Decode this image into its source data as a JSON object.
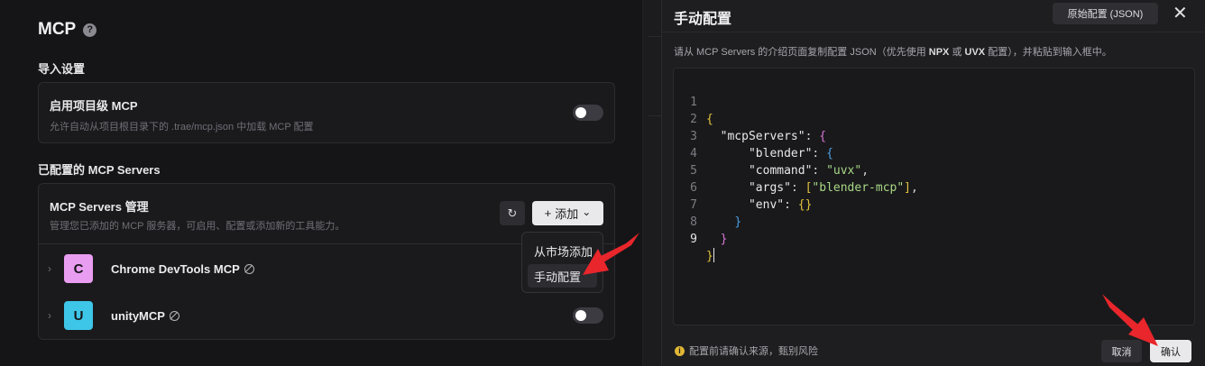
{
  "settings": {
    "title": "MCP",
    "help_icon": "?",
    "import_section": "导入设置",
    "project_mcp": {
      "title": "启用项目级 MCP",
      "desc": "允许自动从项目根目录下的 .trae/mcp.json 中加载 MCP 配置",
      "enabled": false
    },
    "configured_section": "已配置的 MCP Servers",
    "manage": {
      "title": "MCP Servers 管理",
      "desc": "管理您已添加的 MCP 服务器，可启用、配置或添加新的工具能力。",
      "refresh_icon": "↻",
      "add_label": "添加",
      "add_plus": "+",
      "add_chevron": "⌄"
    },
    "servers": [
      {
        "letter": "C",
        "name": "Chrome DevTools MCP",
        "color": "#e99df1",
        "enabled": false
      },
      {
        "letter": "U",
        "name": "unityMCP",
        "color": "#3ec6e8",
        "enabled": false
      }
    ],
    "dropdown": {
      "items": [
        "从市场添加",
        "手动配置"
      ],
      "highlighted": "手动配置"
    }
  },
  "dialog": {
    "title": "手动配置",
    "raw_button": "原始配置 (JSON)",
    "close_icon": "✕",
    "instructions_pre": "请从 MCP Servers 的介绍页面复制配置 JSON（优先使用 ",
    "instructions_npx": "NPX",
    "instructions_mid": " 或 ",
    "instructions_uvx": "UVX",
    "instructions_post": " 配置），并粘贴到输入框中。",
    "line_numbers": [
      "1",
      "2",
      "3",
      "4",
      "5",
      "6",
      "7",
      "8",
      "9"
    ],
    "code": {
      "open": "{",
      "mcpServers_key": "\"mcpServers\"",
      "blender_key": "\"blender\"",
      "command_key": "\"command\"",
      "command_val": "\"uvx\"",
      "args_key": "\"args\"",
      "args_val": "\"blender-mcp\"",
      "env_key": "\"env\"",
      "env_val": "{}",
      "close": "}"
    },
    "warning": "配置前请确认来源，甄别风险",
    "warning_icon": "i",
    "cancel_label": "取消",
    "confirm_label": "确认"
  },
  "colors": {
    "accent": "#e9e9ec",
    "arrow": "#e8262b",
    "string": "#a9d886",
    "brace_l1": "#e3c33d",
    "brace_l2": "#d874d6",
    "brace_l3": "#4b9fe3"
  }
}
